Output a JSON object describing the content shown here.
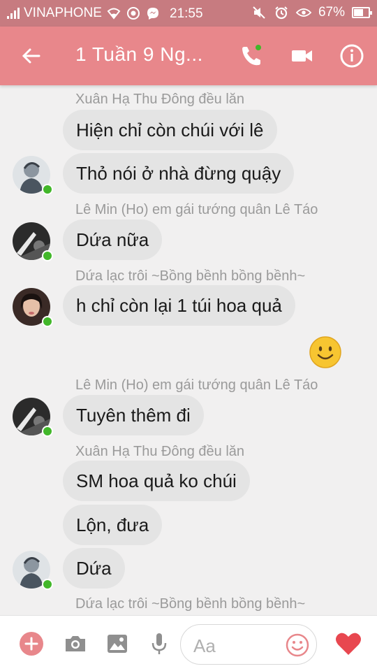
{
  "status_bar": {
    "carrier": "VINAPHONE",
    "time": "21:55",
    "battery_percent": "67%",
    "battery_level": 0.67,
    "icons": [
      "signal-icon",
      "wifi-icon",
      "chrome-icon",
      "messenger-icon",
      "mute-icon",
      "alarm-icon",
      "eye-icon",
      "battery-icon"
    ]
  },
  "header": {
    "title": "1 Tuần 9 Ng...",
    "back_icon": "arrow-left-icon",
    "call_icon": "phone-icon",
    "video_icon": "video-camera-icon",
    "info_icon": "info-icon"
  },
  "messages": [
    {
      "sender": "Xuân Hạ Thu Đông đều lăn",
      "bubbles": [
        "Hiện chỉ còn chúi với lê",
        "Thỏ nói ở nhà đừng quậy"
      ],
      "avatar": "avatar-xuan-ha"
    },
    {
      "sender": "Lê Min (Ho) em gái tướng quân Lê Táo",
      "bubbles": [
        "Dứa nữa"
      ],
      "avatar": "avatar-le-min"
    },
    {
      "sender": "Dứa lạc trôi ~Bồng bềnh bồng bềnh~",
      "bubbles": [
        "h chỉ còn lại 1 túi hoa quả"
      ],
      "avatar": "avatar-dua"
    },
    {
      "sender": "",
      "bubbles": [],
      "emoji": "smiley-emoji-icon"
    },
    {
      "sender": "Lê Min (Ho) em gái tướng quân Lê Táo",
      "bubbles": [
        "Tuyên thêm đi"
      ],
      "avatar": "avatar-le-min"
    },
    {
      "sender": "Xuân Hạ Thu Đông đều lăn",
      "bubbles": [
        "SM hoa quả ko chúi",
        "Lộn, đưa",
        "Dứa"
      ],
      "avatar": "avatar-xuan-ha"
    },
    {
      "sender": "Dứa lạc trôi ~Bồng bềnh bồng bềnh~",
      "bubbles": []
    }
  ],
  "composer": {
    "placeholder": "Aa",
    "icons": [
      "plus-icon",
      "camera-icon",
      "image-icon",
      "microphone-icon",
      "emoji-icon",
      "heart-icon"
    ]
  },
  "colors": {
    "status_bar": "#c77b80",
    "header": "#e8878b",
    "accent": "#e8878b",
    "bubble": "#e4e4e4",
    "online": "#42b72a",
    "heart": "#e8474f"
  }
}
